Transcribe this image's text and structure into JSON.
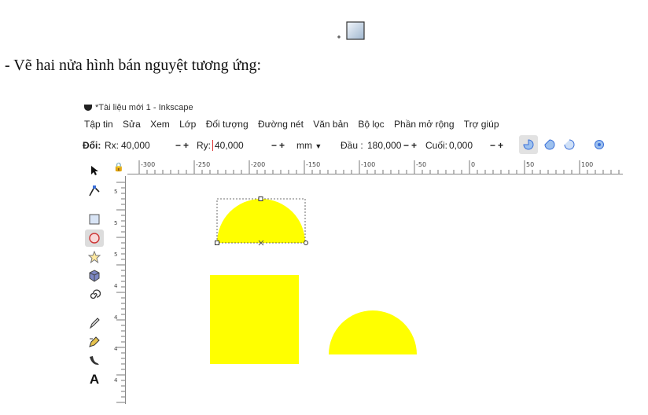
{
  "instruction": "- Vẽ hai nửa hình bán nguyệt tương ứng:",
  "window_title": "*Tài liệu mới 1 - Inkscape",
  "menu": [
    "Tập tin",
    "Sửa",
    "Xem",
    "Lớp",
    "Đối tượng",
    "Đường nét",
    "Văn bản",
    "Bộ lọc",
    "Phần mở rộng",
    "Trợ giúp"
  ],
  "controls": {
    "label": "Đổi:",
    "rx_label": "Rx:",
    "rx_value": "40,000",
    "ry_label": "Ry:",
    "ry_value": "40,000",
    "unit": "mm",
    "start_label": "Đầu :",
    "start_value": "180,000",
    "end_label": "Cuối:",
    "end_value": "0,000"
  },
  "ruler_labels": [
    "-300",
    "-250",
    "-200",
    "-150",
    "-100",
    "-50",
    "0",
    "50",
    "100"
  ],
  "vruler_labels": [
    "5",
    "5",
    "5",
    "4",
    "4",
    "4",
    "4"
  ],
  "colors": {
    "shape_fill": "#ffff00",
    "selection": "#333333",
    "ruler_tick": "#555555",
    "accent_blue": "#3b6fd8"
  },
  "tools": [
    "select-arrow-icon",
    "node-edit-icon",
    "rectangle-icon",
    "ellipse-icon",
    "star-icon",
    "3d-box-icon",
    "spiral-icon",
    "pencil-icon",
    "pen-icon",
    "calligraphy-icon",
    "text-icon"
  ],
  "text_tool_glyph": "A"
}
